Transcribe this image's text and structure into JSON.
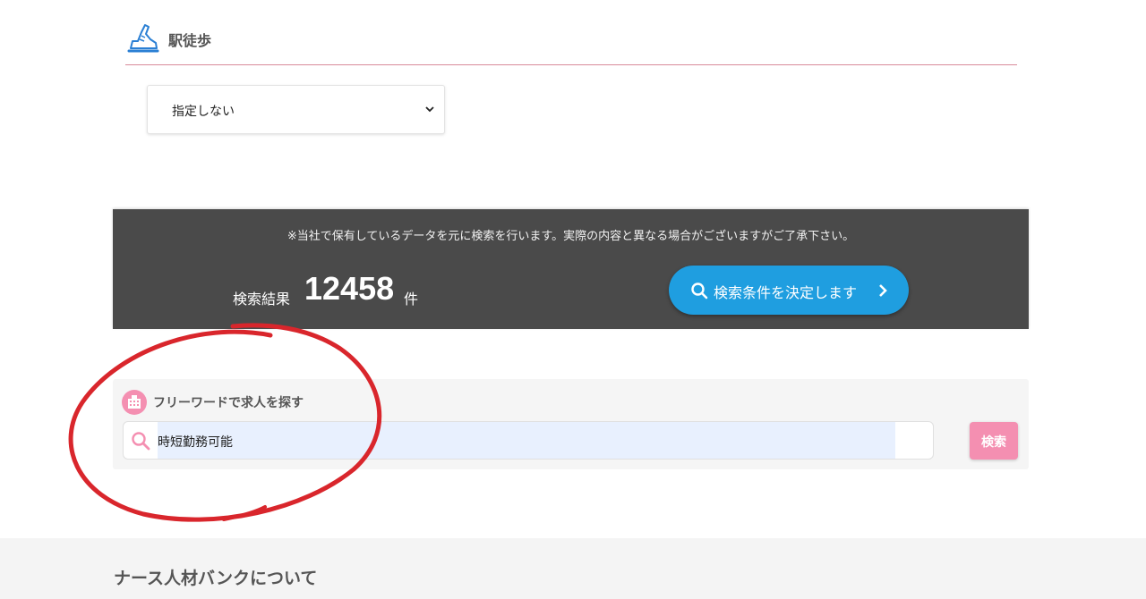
{
  "walk_section": {
    "title": "駅徒歩",
    "icon": "shoe-icon",
    "select_value": "指定しない"
  },
  "results": {
    "note": "※当社で保有しているデータを元に検索を行います。実際の内容と異なる場合がございますがご了承下さい。",
    "label": "検索結果",
    "count": "12458",
    "unit": "件",
    "decide_button_label": "検索条件を決定します"
  },
  "freeword": {
    "title": "フリーワードで求人を探す",
    "icon": "building-icon",
    "input_value": "時短勤務可能",
    "search_button_label": "検索"
  },
  "footer": {
    "title": "ナース人材バンクについて"
  },
  "colors": {
    "accent_blue": "#1f9ee0",
    "accent_pink": "#f48fb1",
    "dark_band": "#4a4a4a",
    "annotation_red": "#d9262c"
  }
}
